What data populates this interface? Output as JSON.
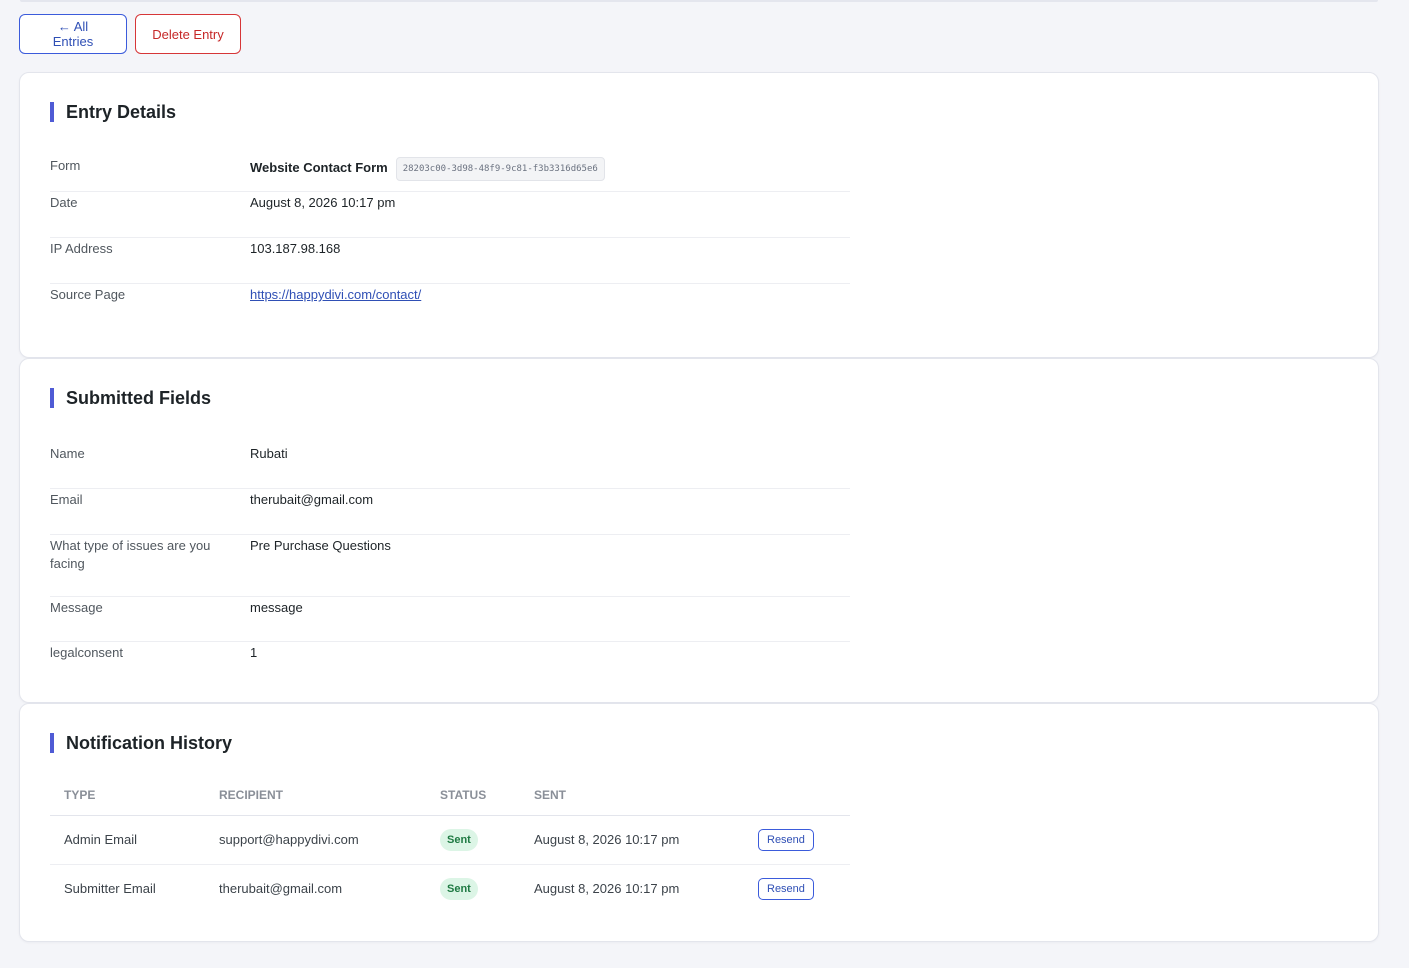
{
  "actions": {
    "back_label": "← All Entries",
    "delete_label": "Delete Entry"
  },
  "entry_details": {
    "title": "Entry Details",
    "rows": [
      {
        "label": "Form",
        "value": "Website Contact Form",
        "id": "28203c00-3d98-48f9-9c81-f3b3316d65e6"
      },
      {
        "label": "Date",
        "value": "August 8, 2026 10:17 pm"
      },
      {
        "label": "IP Address",
        "value": "103.187.98.168"
      },
      {
        "label": "Source Page",
        "value": "https://happydivi.com/contact/"
      }
    ]
  },
  "submitted_fields": {
    "title": "Submitted Fields",
    "rows": [
      {
        "label": "Name",
        "value": "Rubati"
      },
      {
        "label": "Email",
        "value": "therubait@gmail.com"
      },
      {
        "label": "What type of issues are you facing",
        "value": "Pre Purchase Questions"
      },
      {
        "label": "Message",
        "value": "message"
      },
      {
        "label": "legalconsent",
        "value": "1"
      }
    ]
  },
  "notification_history": {
    "title": "Notification History",
    "columns": [
      "Type",
      "Recipient",
      "Status",
      "Sent"
    ],
    "rows": [
      {
        "type": "Admin Email",
        "recipient": "support@happydivi.com",
        "status": "Sent",
        "sent": "August 8, 2026 10:17 pm",
        "action": "Resend"
      },
      {
        "type": "Submitter Email",
        "recipient": "therubait@gmail.com",
        "status": "Sent",
        "sent": "August 8, 2026 10:17 pm",
        "action": "Resend"
      }
    ]
  },
  "colors": {
    "accent": "#4f5bd5",
    "link": "#2f4fb5",
    "danger": "#d63638",
    "success_bg": "#dcf5e6",
    "success_text": "#1f7a43"
  }
}
